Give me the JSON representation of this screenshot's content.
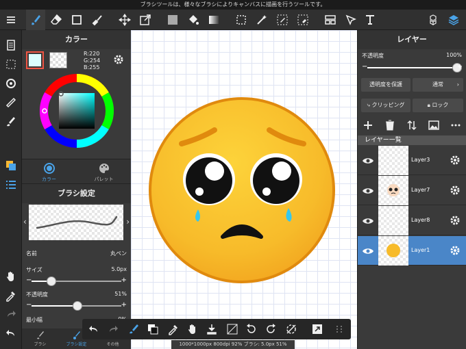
{
  "tooltip": "ブラシツールは、様々なブラシによりキャンバスに描画を行うツールです。",
  "toolbar": {
    "icons": [
      "menu-icon",
      "brush-icon",
      "eraser-icon",
      "rectangle-icon",
      "smudge-icon",
      "move-icon",
      "transform-icon",
      "fill-color-icon",
      "bucket-icon",
      "gradient-icon",
      "select-rect-icon",
      "magic-wand-icon",
      "select-pen-icon",
      "select-eraser-icon",
      "ruler-icon",
      "text-select-icon",
      "text-icon",
      "material-icon",
      "layer-icon"
    ]
  },
  "color_panel": {
    "title": "カラー",
    "r": "R:220",
    "g": "G:254",
    "b": "B:255",
    "main_color": "#dcfeff",
    "tab_color": "カラー",
    "tab_palette": "パレット"
  },
  "brush_panel": {
    "title": "ブラシ設定",
    "name_label": "名前",
    "name_value": "丸ペン",
    "size_label": "サイズ",
    "size_value": "5.0px",
    "size_level": 0.22,
    "opacity_label": "不透明度",
    "opacity_value": "51%",
    "opacity_level": 0.51,
    "min_width_label": "最小幅",
    "min_width_value": "0%"
  },
  "bottom_tabs": [
    "ブラシ",
    "ブラシ設定",
    "その他"
  ],
  "status": "1000*1000px 800dpi 92% ブラシ: 5.0px 51%",
  "layer_panel": {
    "title": "レイヤー",
    "opacity_label": "不透明度",
    "opacity_value": "100%",
    "opacity_level": 1.0,
    "protect_label": "透明度を保護",
    "blend_label": "通常",
    "clipping_label": "クリッピング",
    "lock_label": "ロック",
    "list_label": "レイヤー一覧",
    "layers": [
      {
        "name": "Layer3",
        "selected": false
      },
      {
        "name": "Layer7",
        "selected": false
      },
      {
        "name": "Layer8",
        "selected": false
      },
      {
        "name": "Layer1",
        "selected": true
      }
    ]
  },
  "colors": {
    "accent": "#4a86c8",
    "emoji_face": "#f7bb2a",
    "emoji_outline": "#e08a0e",
    "tear": "#35c8ee"
  }
}
